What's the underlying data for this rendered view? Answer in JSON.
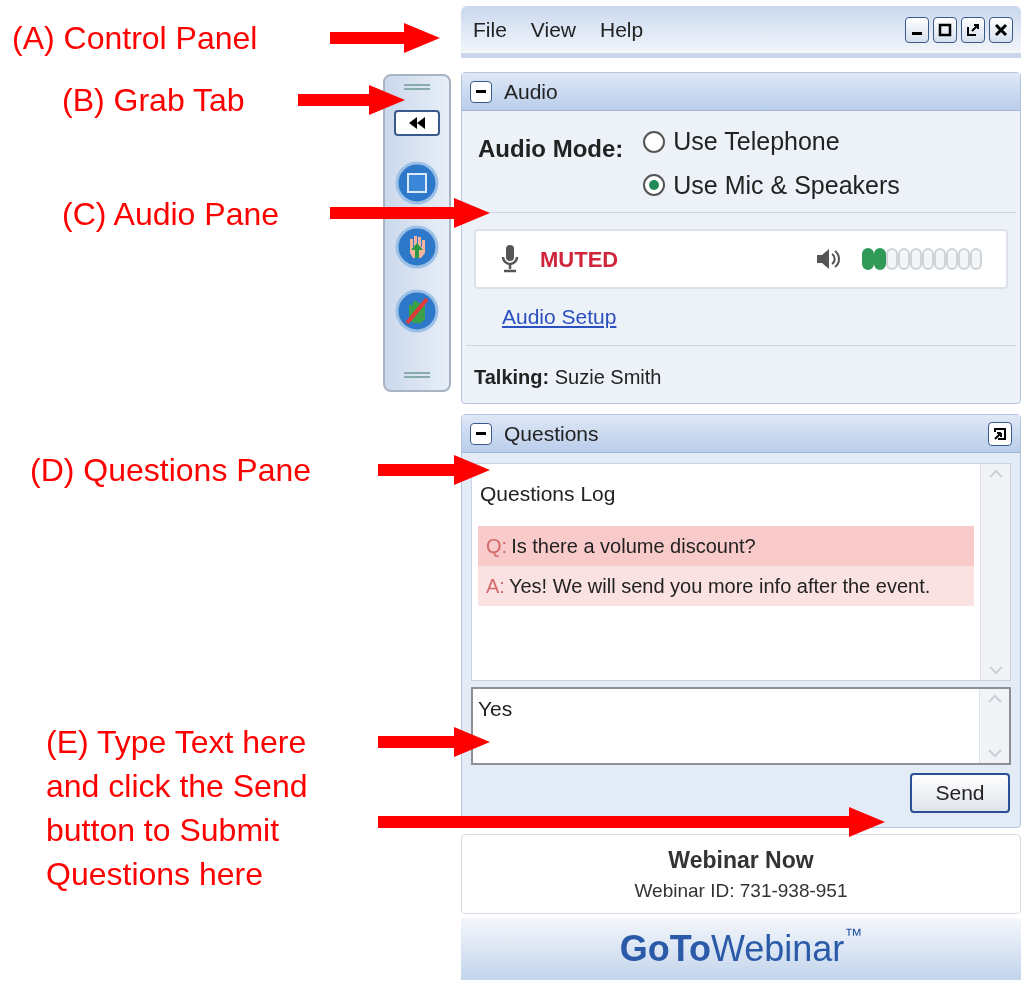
{
  "annotations": [
    {
      "text": "(A) Control Panel"
    },
    {
      "text": "(B) Grab Tab"
    },
    {
      "text": "(C) Audio Pane"
    },
    {
      "text": "(D) Questions  Pane"
    },
    {
      "text": "(E) Type Text here\nand click the Send\nbutton to Submit\nQuestions here"
    }
  ],
  "menu": [
    "File",
    "View",
    "Help"
  ],
  "audio": {
    "title": "Audio",
    "mode_label": "Audio Mode:",
    "options": [
      {
        "label": "Use Telephone",
        "selected": false
      },
      {
        "label": "Use Mic & Speakers",
        "selected": true
      }
    ],
    "mic_status": "MUTED",
    "setup_link": "Audio Setup",
    "talking": "**Talking:** Suzie Smith"
  },
  "questions": {
    "title": "Questions",
    "log_title": "Questions Log",
    "entries": [
      {
        "kind": "question",
        "prefix": "Q:",
        "text": "Is there a volume discount?"
      },
      {
        "kind": "answer",
        "prefix": "A:",
        "text": "Yes! We will send you more info after the event."
      }
    ],
    "input_value": "Yes",
    "send": "Send"
  },
  "webinar": {
    "title": "Webinar Now",
    "id": "Webinar ID: 731-938-951"
  },
  "logo": {
    "bold": "GoTo",
    "light": "Webinar",
    "mark": "™"
  }
}
